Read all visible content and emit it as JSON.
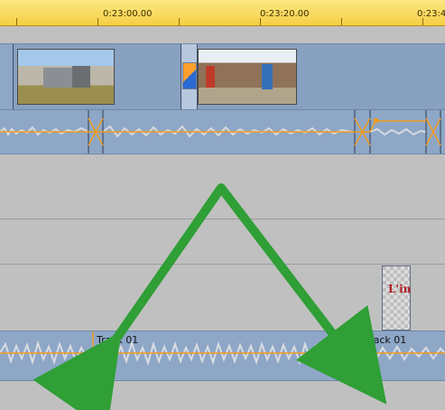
{
  "ruler": {
    "times": [
      "0:23:00.00",
      "0:23:20.00",
      "0:23:4"
    ]
  },
  "bottom_track": {
    "clip1_label": "Track 01",
    "clip2_label": "Track 01"
  },
  "title_clip": {
    "text": "L'in"
  },
  "colors": {
    "ruler_top": "#fde783",
    "ruler_bottom": "#f5cf44",
    "track": "#8ea7c7",
    "envelope": "#f39c1f",
    "annotation_arrow": "#2f9f36"
  },
  "icons": [
    "transition-icon"
  ]
}
